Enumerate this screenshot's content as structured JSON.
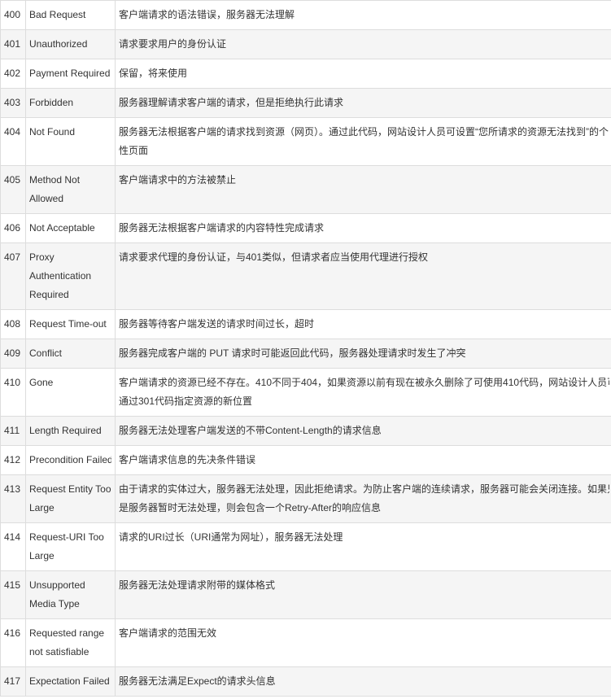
{
  "colors": {
    "text": "#333333",
    "border": "#dddddd",
    "row_alt": "#f5f5f5",
    "row": "#ffffff"
  },
  "table": {
    "rows": [
      {
        "code": "400",
        "name_lines": [
          "Bad Request"
        ],
        "desc_lines": [
          "客户端请求的语法错误，服务器无法理解"
        ]
      },
      {
        "code": "401",
        "name_lines": [
          "Unauthorized"
        ],
        "desc_lines": [
          "请求要求用户的身份认证"
        ]
      },
      {
        "code": "402",
        "name_lines": [
          "Payment Required"
        ],
        "desc_lines": [
          "保留，将来使用"
        ]
      },
      {
        "code": "403",
        "name_lines": [
          "Forbidden"
        ],
        "desc_lines": [
          "服务器理解请求客户端的请求，但是拒绝执行此请求"
        ]
      },
      {
        "code": "404",
        "name_lines": [
          "Not Found"
        ],
        "desc_lines": [
          "服务器无法根据客户端的请求找到资源（网页）。通过此代码，网站设计人员可设置“您所请求的资源无法找到”的个",
          "性页面"
        ]
      },
      {
        "code": "405",
        "name_lines": [
          "Method Not",
          "Allowed"
        ],
        "desc_lines": [
          "客户端请求中的方法被禁止"
        ]
      },
      {
        "code": "406",
        "name_lines": [
          "Not Acceptable"
        ],
        "desc_lines": [
          "服务器无法根据客户端请求的内容特性完成请求"
        ]
      },
      {
        "code": "407",
        "name_lines": [
          "Proxy",
          "Authentication",
          "Required"
        ],
        "desc_lines": [
          "请求要求代理的身份认证，与401类似，但请求者应当使用代理进行授权"
        ]
      },
      {
        "code": "408",
        "name_lines": [
          "Request Time-out"
        ],
        "desc_lines": [
          "服务器等待客户端发送的请求时间过长，超时"
        ]
      },
      {
        "code": "409",
        "name_lines": [
          "Conflict"
        ],
        "desc_lines": [
          "服务器完成客户端的 PUT 请求时可能返回此代码，服务器处理请求时发生了冲突"
        ]
      },
      {
        "code": "410",
        "name_lines": [
          "Gone"
        ],
        "desc_lines": [
          "客户端请求的资源已经不存在。410不同于404，如果资源以前有现在被永久删除了可使用410代码，网站设计人员可",
          "通过301代码指定资源的新位置"
        ]
      },
      {
        "code": "411",
        "name_lines": [
          "Length Required"
        ],
        "desc_lines": [
          "服务器无法处理客户端发送的不带Content-Length的请求信息"
        ]
      },
      {
        "code": "412",
        "name_lines": [
          "Precondition Failed"
        ],
        "desc_lines": [
          "客户端请求信息的先决条件错误"
        ]
      },
      {
        "code": "413",
        "name_lines": [
          "Request Entity Too",
          "Large"
        ],
        "desc_lines": [
          "由于请求的实体过大，服务器无法处理，因此拒绝请求。为防止客户端的连续请求，服务器可能会关闭连接。如果只",
          "是服务器暂时无法处理，则会包含一个Retry-After的响应信息"
        ]
      },
      {
        "code": "414",
        "name_lines": [
          "Request-URI Too",
          "Large"
        ],
        "desc_lines": [
          "请求的URI过长（URI通常为网址），服务器无法处理"
        ]
      },
      {
        "code": "415",
        "name_lines": [
          "Unsupported",
          "Media Type"
        ],
        "desc_lines": [
          "服务器无法处理请求附带的媒体格式"
        ]
      },
      {
        "code": "416",
        "name_lines": [
          "Requested range",
          "not satisfiable"
        ],
        "desc_lines": [
          "客户端请求的范围无效"
        ]
      },
      {
        "code": "417",
        "name_lines": [
          "Expectation Failed"
        ],
        "desc_lines": [
          "服务器无法满足Expect的请求头信息"
        ]
      }
    ]
  }
}
